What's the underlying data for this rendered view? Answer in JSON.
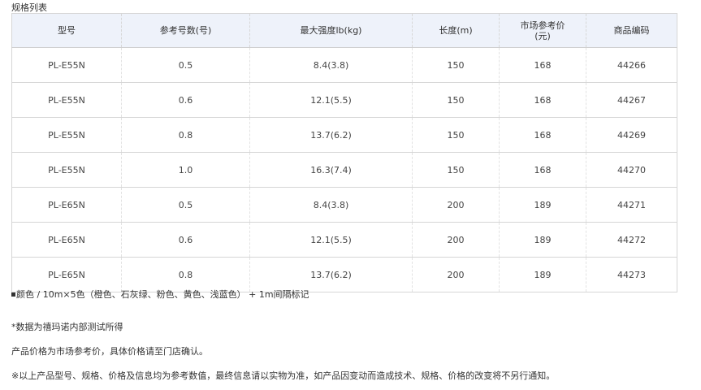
{
  "caption": "规格列表",
  "table": {
    "headers": [
      {
        "line1": "型号",
        "line2": ""
      },
      {
        "line1": "参考号数(号)",
        "line2": ""
      },
      {
        "line1": "最大强度lb(kg)",
        "line2": ""
      },
      {
        "line1": "长度(m)",
        "line2": ""
      },
      {
        "line1": "市场参考价",
        "line2": "(元)"
      },
      {
        "line1": "商品编码",
        "line2": ""
      }
    ],
    "rows": [
      [
        "PL-E55N",
        "0.5",
        "8.4(3.8)",
        "150",
        "168",
        "44266"
      ],
      [
        "PL-E55N",
        "0.6",
        "12.1(5.5)",
        "150",
        "168",
        "44267"
      ],
      [
        "PL-E55N",
        "0.8",
        "13.7(6.2)",
        "150",
        "168",
        "44269"
      ],
      [
        "PL-E55N",
        "1.0",
        "16.3(7.4)",
        "150",
        "168",
        "44270"
      ],
      [
        "PL-E65N",
        "0.5",
        "8.4(3.8)",
        "200",
        "189",
        "44271"
      ],
      [
        "PL-E65N",
        "0.6",
        "12.1(5.5)",
        "200",
        "189",
        "44272"
      ],
      [
        "PL-E65N",
        "0.8",
        "13.7(6.2)",
        "200",
        "189",
        "44273"
      ]
    ]
  },
  "notes": {
    "color_note": "颜色 / 10m×5色（橙色、石灰绿、粉色、黄色、浅蓝色） + 1m间隔标记",
    "data_note": "*数据为禧玛诺内部测试所得",
    "price_note": "产品价格为市场参考价，具体价格请至门店确认。",
    "disclaimer": "※以上产品型号、规格、价格及信息均为参考数值，最终信息请以实物为准，如产品因变动而造成技术、规格、价格的改变将不另行通知。"
  }
}
